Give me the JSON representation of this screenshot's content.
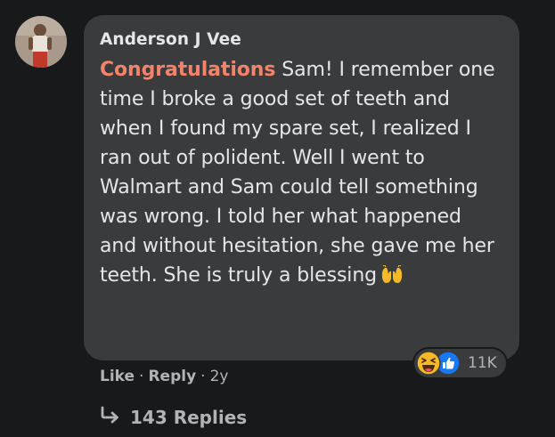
{
  "comment": {
    "author": "Anderson J Vee",
    "highlight_word": "Congratulations",
    "body_text": " Sam! I remember one time I broke a good set of teeth and when I found my spare set, I realized I ran out of polident. Well I went to Walmart and Sam could tell something was wrong. I told her what happened and without hesitation, she gave me her teeth. She is truly a blessing",
    "trailing_emoji": "raising-hands-icon"
  },
  "reactions": {
    "icons": [
      "laughing-face-icon",
      "thumbs-up-icon"
    ],
    "count": "11K"
  },
  "actions": {
    "like": "Like",
    "separator": "·",
    "reply": "Reply",
    "age": "2y"
  },
  "replies": {
    "label": "143 Replies"
  },
  "colors": {
    "background": "#18191a",
    "bubble": "#3a3b3c",
    "text": "#e4e6eb",
    "secondary": "#b0b3b8",
    "highlight": "#f3836a",
    "like_blue": "#1877f2",
    "laugh_yellow": "#f7b928"
  }
}
